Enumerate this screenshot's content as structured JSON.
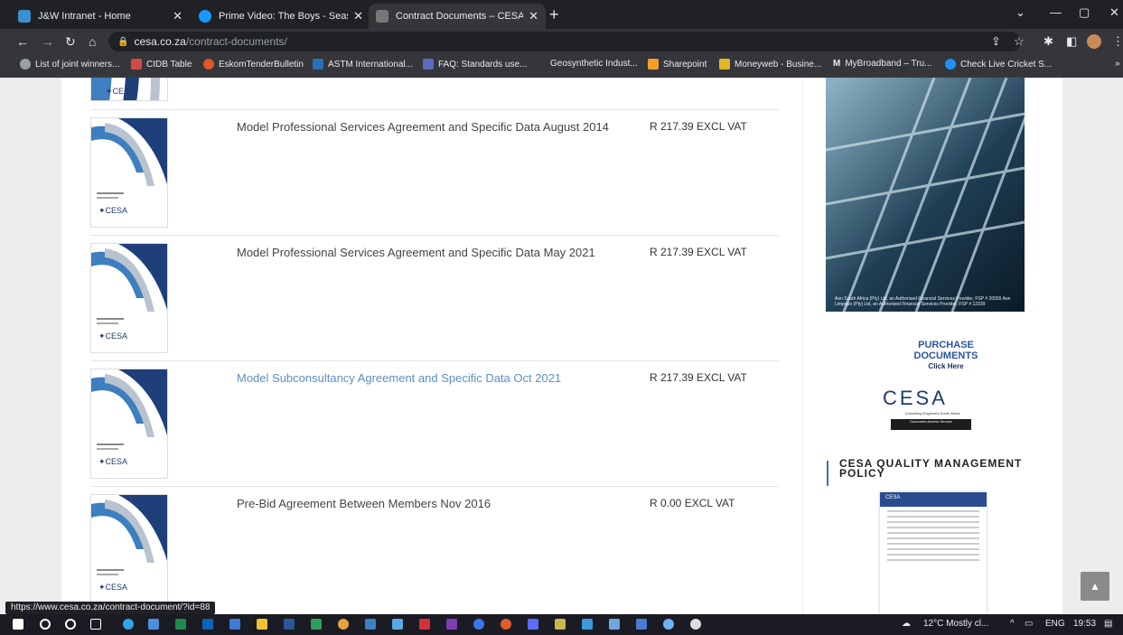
{
  "tabs": [
    {
      "title": "J&W Intranet - Home",
      "fav_color": "#3c8ecf"
    },
    {
      "title": "Prime Video: The Boys - Season",
      "fav_color": "#1a98ff"
    },
    {
      "title": "Contract Documents – CESA | Co",
      "fav_color": "#777777"
    }
  ],
  "url": {
    "host": "cesa.co.za",
    "path": "/contract-documents/"
  },
  "bookmarks": [
    {
      "label": "List of joint winners...",
      "color": "#9aa0a6"
    },
    {
      "label": "CIDB Table",
      "color": "#d04a4a"
    },
    {
      "label": "EskomTenderBulletin",
      "color": "#e0552a"
    },
    {
      "label": "ASTM International...",
      "color": "#2a6fb8"
    },
    {
      "label": "FAQ: Standards use...",
      "color": "#5c6bc0"
    },
    {
      "label": "Geosynthetic Indust...",
      "color": "#35363a"
    },
    {
      "label": "Sharepoint",
      "color": "#f3a12b"
    },
    {
      "label": "Moneyweb - Busine...",
      "color": "#e2b62a"
    },
    {
      "label": "MyBroadband – Tru...",
      "color": "#ffffff"
    },
    {
      "label": "Check Live Cricket S...",
      "color": "#1e90ff"
    }
  ],
  "documents": [
    {
      "title": "Model Professional Services Agreement and Specific Data August 2014",
      "price": "R 217.39 EXCL VAT"
    },
    {
      "title": "Model Professional Services Agreement and Specific Data May 2021",
      "price": "R 217.39 EXCL VAT"
    },
    {
      "title": "Model Subconsultancy Agreement and Specific Data Oct 2021",
      "price": "R 217.39 EXCL VAT"
    },
    {
      "title": "Pre-Bid Agreement Between Members Nov 2016",
      "price": "R 0.00 EXCL VAT"
    }
  ],
  "thumb_brand": "CESA",
  "sidebar": {
    "aon_note": "Aon South Africa (Pty) Ltd, an Authorised Financial Services Provider, FSP # 20555 Aon Limpopo (Pty) Ltd, an Authorised Financial Services Provider, FSP # 12339",
    "purchase_line1": "PURCHASE",
    "purchase_line2": "DOCUMENTS",
    "purchase_click": "Click Here",
    "cesa_logo": "CESA",
    "cesa_sub": "Consulting Engineers South Africa",
    "das": "Document Access Service",
    "qmp_title": "CESA QUALITY MANAGEMENT POLICY",
    "policy_header": "CESA"
  },
  "status_url": "https://www.cesa.co.za/contract-document/?id=88",
  "tray": {
    "weather": "12°C  Mostly cl...",
    "lang": "ENG",
    "time": "19:53"
  }
}
